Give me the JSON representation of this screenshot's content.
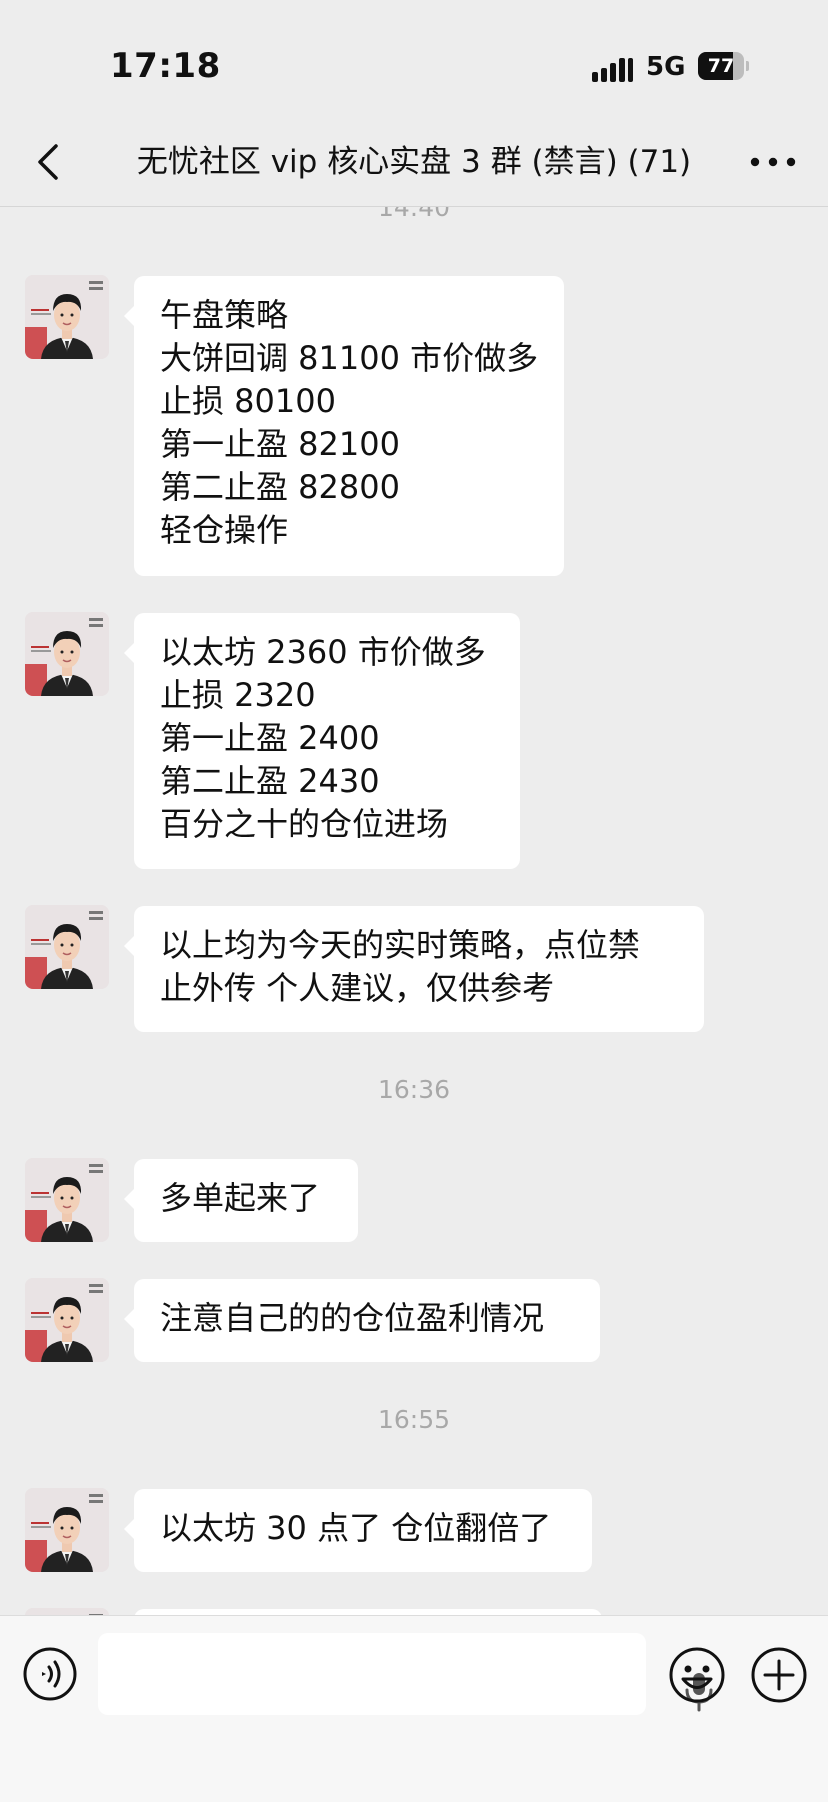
{
  "status_bar": {
    "time": "17:18",
    "network": "5G",
    "battery": "77",
    "battery_level": 0.77
  },
  "header": {
    "title": "无忧社区 vip 核心实盘 3 群 (禁言) (71)",
    "back_icon": "chevron-left-icon",
    "more_icon": "more-dots-icon"
  },
  "timestamps": [
    "14:40",
    "16:36",
    "16:55"
  ],
  "messages": [
    {
      "lines": [
        "午盘策略",
        "大饼回调 81100 市价做多",
        "止损 80100",
        "第一止盈 82100",
        "第二止盈 82800",
        "轻仓操作"
      ]
    },
    {
      "lines": [
        "以太坊 2360 市价做多",
        "止损 2320",
        "第一止盈 2400",
        "第二止盈 2430",
        "百分之十的仓位进场"
      ]
    },
    {
      "lines": [
        "以上均为今天的实时策略，点位禁",
        "止外传 个人建议，仅供参考"
      ]
    },
    {
      "lines": [
        "多单起来了"
      ]
    },
    {
      "lines": [
        "注意自己的的仓位盈利情况"
      ]
    },
    {
      "lines": [
        "以太坊 30 点了 仓位翻倍了"
      ]
    },
    {
      "lines": []
    }
  ],
  "input_bar": {
    "voice_icon": "voice-wave-icon",
    "mic_icon": "microphone-icon",
    "emoji_icon": "emoji-icon",
    "plus_icon": "plus-circle-icon"
  },
  "colors": {
    "background": "#ededed",
    "bubble": "#ffffff",
    "timestamp": "#a8a8a8"
  }
}
